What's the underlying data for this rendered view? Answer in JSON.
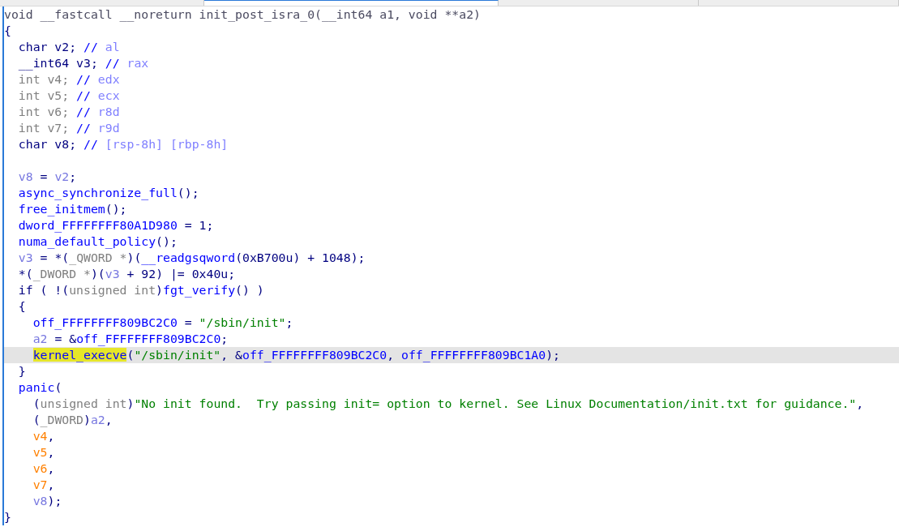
{
  "tabs": [
    {
      "selected": false
    },
    {
      "selected": true
    },
    {
      "selected": false
    },
    {
      "selected": false
    }
  ],
  "code": {
    "lines": [
      {
        "tokens": [
          {
            "text": "void __fastcall __noreturn init_post_isra_0(__int64 a1, void **a2)",
            "kind": "sig"
          }
        ]
      },
      {
        "tokens": [
          {
            "text": "{",
            "kind": "plain"
          }
        ]
      },
      {
        "tokens": [
          {
            "text": "  char v2; ",
            "kind": "plain"
          },
          {
            "text": "// ",
            "kind": "comment"
          },
          {
            "text": "al",
            "kind": "reg"
          }
        ]
      },
      {
        "tokens": [
          {
            "text": "  __int64 v3; ",
            "kind": "plain"
          },
          {
            "text": "// ",
            "kind": "comment"
          },
          {
            "text": "rax",
            "kind": "reg"
          }
        ]
      },
      {
        "tokens": [
          {
            "text": "  int v4; ",
            "kind": "cast"
          },
          {
            "text": "// ",
            "kind": "comment"
          },
          {
            "text": "edx",
            "kind": "reg"
          }
        ]
      },
      {
        "tokens": [
          {
            "text": "  int v5; ",
            "kind": "cast"
          },
          {
            "text": "// ",
            "kind": "comment"
          },
          {
            "text": "ecx",
            "kind": "reg"
          }
        ]
      },
      {
        "tokens": [
          {
            "text": "  int v6; ",
            "kind": "cast"
          },
          {
            "text": "// ",
            "kind": "comment"
          },
          {
            "text": "r8d",
            "kind": "reg"
          }
        ]
      },
      {
        "tokens": [
          {
            "text": "  int v7; ",
            "kind": "cast"
          },
          {
            "text": "// ",
            "kind": "comment"
          },
          {
            "text": "r9d",
            "kind": "reg"
          }
        ]
      },
      {
        "tokens": [
          {
            "text": "  char v8; ",
            "kind": "plain"
          },
          {
            "text": "// ",
            "kind": "comment"
          },
          {
            "text": "[rsp-8h] [rbp-8h]",
            "kind": "reg"
          }
        ]
      },
      {
        "gap_before": true,
        "tokens": [
          {
            "text": "  v8",
            "kind": "var"
          },
          {
            "text": " = ",
            "kind": "plain"
          },
          {
            "text": "v2",
            "kind": "var"
          },
          {
            "text": ";",
            "kind": "plain"
          }
        ]
      },
      {
        "tokens": [
          {
            "text": "  async_synchronize_full",
            "kind": "func"
          },
          {
            "text": "();",
            "kind": "plain"
          }
        ]
      },
      {
        "tokens": [
          {
            "text": "  free_initmem",
            "kind": "func"
          },
          {
            "text": "();",
            "kind": "plain"
          }
        ]
      },
      {
        "tokens": [
          {
            "text": "  dword_FFFFFFFF80A1D980",
            "kind": "func"
          },
          {
            "text": " = 1;",
            "kind": "plain"
          }
        ]
      },
      {
        "tokens": [
          {
            "text": "  numa_default_policy",
            "kind": "func"
          },
          {
            "text": "();",
            "kind": "plain"
          }
        ]
      },
      {
        "tokens": [
          {
            "text": "  v3",
            "kind": "var"
          },
          {
            "text": " = *(",
            "kind": "plain"
          },
          {
            "text": "_QWORD *",
            "kind": "cast"
          },
          {
            "text": ")(",
            "kind": "plain"
          },
          {
            "text": "__readgsqword",
            "kind": "func"
          },
          {
            "text": "(0xB700u) + 1048);",
            "kind": "plain"
          }
        ]
      },
      {
        "tokens": [
          {
            "text": "  *(",
            "kind": "plain"
          },
          {
            "text": "_DWORD *",
            "kind": "cast"
          },
          {
            "text": ")(",
            "kind": "plain"
          },
          {
            "text": "v3",
            "kind": "var"
          },
          {
            "text": " + 92) |= 0x40u;",
            "kind": "plain"
          }
        ]
      },
      {
        "tokens": [
          {
            "text": "  if ( !(",
            "kind": "plain"
          },
          {
            "text": "unsigned int",
            "kind": "cast"
          },
          {
            "text": ")",
            "kind": "plain"
          },
          {
            "text": "fgt_verify",
            "kind": "func"
          },
          {
            "text": "() )",
            "kind": "plain"
          }
        ]
      },
      {
        "tokens": [
          {
            "text": "  {",
            "kind": "plain"
          }
        ]
      },
      {
        "tokens": [
          {
            "text": "    off_FFFFFFFF809BC2C0",
            "kind": "func"
          },
          {
            "text": " = ",
            "kind": "plain"
          },
          {
            "text": "\"/sbin/init\"",
            "kind": "str"
          },
          {
            "text": ";",
            "kind": "plain"
          }
        ]
      },
      {
        "tokens": [
          {
            "text": "    a2",
            "kind": "var"
          },
          {
            "text": " = &",
            "kind": "plain"
          },
          {
            "text": "off_FFFFFFFF809BC2C0",
            "kind": "func"
          },
          {
            "text": ";",
            "kind": "plain"
          }
        ]
      },
      {
        "current": true,
        "tokens": [
          {
            "text": "    kernel_execve",
            "kind": "func",
            "highlight": true
          },
          {
            "text": "(",
            "kind": "plain"
          },
          {
            "text": "\"/sbin/init\"",
            "kind": "str"
          },
          {
            "text": ", &",
            "kind": "plain"
          },
          {
            "text": "off_FFFFFFFF809BC2C0",
            "kind": "func"
          },
          {
            "text": ", ",
            "kind": "plain"
          },
          {
            "text": "off_FFFFFFFF809BC1A0",
            "kind": "func"
          },
          {
            "text": ");",
            "kind": "plain"
          }
        ]
      },
      {
        "tokens": [
          {
            "text": "  }",
            "kind": "plain"
          }
        ]
      },
      {
        "tokens": [
          {
            "text": "  panic",
            "kind": "func"
          },
          {
            "text": "(",
            "kind": "plain"
          }
        ]
      },
      {
        "tokens": [
          {
            "text": "    (",
            "kind": "plain"
          },
          {
            "text": "unsigned int",
            "kind": "cast"
          },
          {
            "text": ")",
            "kind": "plain"
          },
          {
            "text": "\"No init found.  Try passing init= option to kernel. See Linux Documentation/init.txt for guidance.\"",
            "kind": "str"
          },
          {
            "text": ",",
            "kind": "plain"
          }
        ]
      },
      {
        "tokens": [
          {
            "text": "    (",
            "kind": "plain"
          },
          {
            "text": "_DWORD",
            "kind": "cast"
          },
          {
            "text": ")",
            "kind": "plain"
          },
          {
            "text": "a2",
            "kind": "var"
          },
          {
            "text": ",",
            "kind": "plain"
          }
        ]
      },
      {
        "tokens": [
          {
            "text": "    v4",
            "kind": "undef"
          },
          {
            "text": ",",
            "kind": "plain"
          }
        ]
      },
      {
        "tokens": [
          {
            "text": "    v5",
            "kind": "undef"
          },
          {
            "text": ",",
            "kind": "plain"
          }
        ]
      },
      {
        "tokens": [
          {
            "text": "    v6",
            "kind": "undef"
          },
          {
            "text": ",",
            "kind": "plain"
          }
        ]
      },
      {
        "tokens": [
          {
            "text": "    v7",
            "kind": "undef"
          },
          {
            "text": ",",
            "kind": "plain"
          }
        ]
      },
      {
        "tokens": [
          {
            "text": "    v8",
            "kind": "var"
          },
          {
            "text": ");",
            "kind": "plain"
          }
        ]
      },
      {
        "tokens": [
          {
            "text": "}",
            "kind": "plain"
          }
        ]
      }
    ]
  }
}
